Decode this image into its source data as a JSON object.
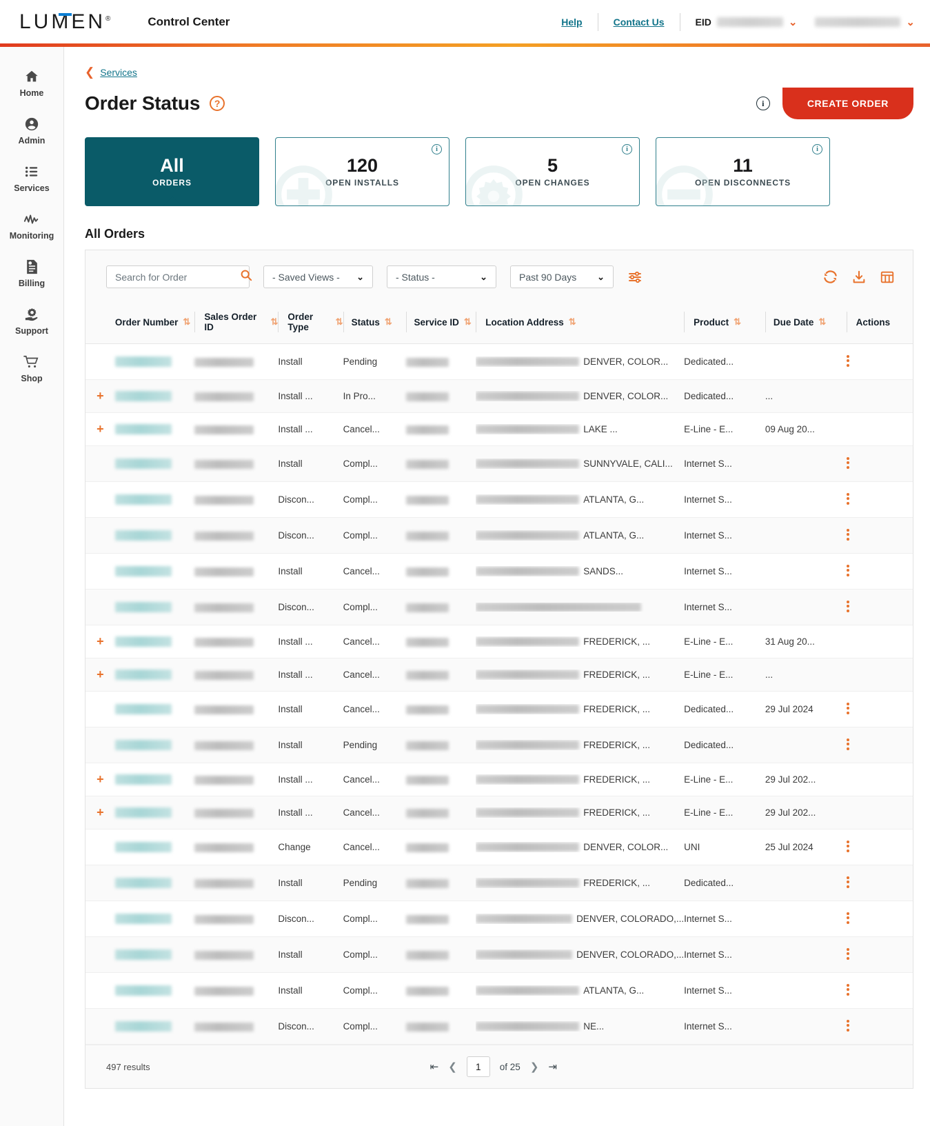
{
  "header": {
    "logo_text": "LUMEN",
    "logo_sup": "®",
    "app_name": "Control Center",
    "help_label": "Help",
    "contact_label": "Contact Us",
    "eid_label": "EID",
    "eid_value": "",
    "account_value": "",
    "caret_icon": "chevron-down-icon"
  },
  "sidebar": {
    "items": [
      {
        "label": "Home",
        "icon": "home-icon"
      },
      {
        "label": "Admin",
        "icon": "user-circle-icon"
      },
      {
        "label": "Services",
        "icon": "list-icon"
      },
      {
        "label": "Monitoring",
        "icon": "activity-icon"
      },
      {
        "label": "Billing",
        "icon": "invoice-icon"
      },
      {
        "label": "Support",
        "icon": "support-hand-gear-icon"
      },
      {
        "label": "Shop",
        "icon": "cart-icon"
      }
    ]
  },
  "breadcrumb": {
    "label": "Services",
    "back_icon": "chevron-left-icon"
  },
  "page": {
    "title": "Order Status",
    "help_icon": "question-circle-icon",
    "info_icon": "info-circle-icon",
    "create_button": "CREATE ORDER"
  },
  "cards": [
    {
      "value": "All",
      "label": "ORDERS",
      "selected": true,
      "watermark": "none"
    },
    {
      "value": "120",
      "label": "OPEN INSTALLS",
      "selected": false,
      "watermark": "plus-circle-icon"
    },
    {
      "value": "5",
      "label": "OPEN CHANGES",
      "selected": false,
      "watermark": "gear-circle-icon"
    },
    {
      "value": "11",
      "label": "OPEN DISCONNECTS",
      "selected": false,
      "watermark": "minus-circle-icon"
    }
  ],
  "section": {
    "title": "All Orders"
  },
  "toolbar": {
    "search_placeholder": "Search for Order",
    "search_value": "",
    "search_icon": "search-icon",
    "saved_views": "- Saved Views -",
    "status_filter": "- Status -",
    "date_range": "Past 90 Days",
    "filter_icon": "sliders-icon",
    "refresh_icon": "refresh-icon",
    "download_icon": "download-icon",
    "columns_icon": "table-columns-icon"
  },
  "table": {
    "columns": [
      {
        "label": "Order Number",
        "sortable": true
      },
      {
        "label": "Sales Order ID",
        "sortable": true
      },
      {
        "label": "Order Type",
        "sortable": true
      },
      {
        "label": "Status",
        "sortable": true
      },
      {
        "label": "Service ID",
        "sortable": true
      },
      {
        "label": "Location Address",
        "sortable": true
      },
      {
        "label": "Product",
        "sortable": true
      },
      {
        "label": "Due Date",
        "sortable": true
      },
      {
        "label": "Actions",
        "sortable": false
      }
    ],
    "sort_icon": "sort-arrows-icon",
    "rows": [
      {
        "expand": false,
        "order_number": "",
        "sales_order_id": "",
        "order_type": "Install",
        "status": "Pending",
        "service_id": "",
        "address_city": "DENVER, COLOR...",
        "product": "Dedicated...",
        "due_date": "",
        "actions": true
      },
      {
        "expand": true,
        "order_number": "",
        "sales_order_id": "",
        "order_type": "Install ...",
        "status": "In Pro...",
        "service_id": "",
        "address_city": "DENVER, COLOR...",
        "product": "Dedicated...",
        "due_date": "...",
        "actions": false
      },
      {
        "expand": true,
        "order_number": "",
        "sales_order_id": "",
        "order_type": "Install ...",
        "status": "Cancel...",
        "service_id": "",
        "address_city": "LAKE ...",
        "product": "E-Line - E...",
        "due_date": "09 Aug 20...",
        "actions": false
      },
      {
        "expand": false,
        "order_number": "",
        "sales_order_id": "",
        "order_type": "Install",
        "status": "Compl...",
        "service_id": "",
        "address_city": "SUNNYVALE, CALI...",
        "product": "Internet S...",
        "due_date": "",
        "actions": true
      },
      {
        "expand": false,
        "order_number": "",
        "sales_order_id": "",
        "order_type": "Discon...",
        "status": "Compl...",
        "service_id": "",
        "address_city": "ATLANTA, G...",
        "product": "Internet S...",
        "due_date": "",
        "actions": true
      },
      {
        "expand": false,
        "order_number": "",
        "sales_order_id": "",
        "order_type": "Discon...",
        "status": "Compl...",
        "service_id": "",
        "address_city": "ATLANTA, G...",
        "product": "Internet S...",
        "due_date": "",
        "actions": true
      },
      {
        "expand": false,
        "order_number": "",
        "sales_order_id": "",
        "order_type": "Install",
        "status": "Cancel...",
        "service_id": "",
        "address_city": "SANDS...",
        "product": "Internet S...",
        "due_date": "",
        "actions": true
      },
      {
        "expand": false,
        "order_number": "",
        "sales_order_id": "",
        "order_type": "Discon...",
        "status": "Compl...",
        "service_id": "",
        "address_city": "",
        "product": "Internet S...",
        "due_date": "",
        "actions": true
      },
      {
        "expand": true,
        "order_number": "",
        "sales_order_id": "",
        "order_type": "Install ...",
        "status": "Cancel...",
        "service_id": "",
        "address_city": "FREDERICK, ...",
        "product": "E-Line - E...",
        "due_date": "31 Aug 20...",
        "actions": false
      },
      {
        "expand": true,
        "order_number": "",
        "sales_order_id": "",
        "order_type": "Install ...",
        "status": "Cancel...",
        "service_id": "",
        "address_city": "FREDERICK, ...",
        "product": "E-Line - E...",
        "due_date": "...",
        "actions": false
      },
      {
        "expand": false,
        "order_number": "",
        "sales_order_id": "",
        "order_type": "Install",
        "status": "Cancel...",
        "service_id": "",
        "address_city": "FREDERICK, ...",
        "product": "Dedicated...",
        "due_date": "29 Jul 2024",
        "actions": true
      },
      {
        "expand": false,
        "order_number": "",
        "sales_order_id": "",
        "order_type": "Install",
        "status": "Pending",
        "service_id": "",
        "address_city": "FREDERICK, ...",
        "product": "Dedicated...",
        "due_date": "",
        "actions": true
      },
      {
        "expand": true,
        "order_number": "",
        "sales_order_id": "",
        "order_type": "Install ...",
        "status": "Cancel...",
        "service_id": "",
        "address_city": "FREDERICK, ...",
        "product": "E-Line - E...",
        "due_date": "29 Jul 202...",
        "actions": false
      },
      {
        "expand": true,
        "order_number": "",
        "sales_order_id": "",
        "order_type": "Install ...",
        "status": "Cancel...",
        "service_id": "",
        "address_city": "FREDERICK, ...",
        "product": "E-Line - E...",
        "due_date": "29 Jul 202...",
        "actions": false
      },
      {
        "expand": false,
        "order_number": "",
        "sales_order_id": "",
        "order_type": "Change",
        "status": "Cancel...",
        "service_id": "",
        "address_city": "DENVER, COLOR...",
        "product": "UNI",
        "due_date": "25 Jul 2024",
        "actions": true
      },
      {
        "expand": false,
        "order_number": "",
        "sales_order_id": "",
        "order_type": "Install",
        "status": "Pending",
        "service_id": "",
        "address_city": "FREDERICK, ...",
        "product": "Dedicated...",
        "due_date": "",
        "actions": true
      },
      {
        "expand": false,
        "order_number": "",
        "sales_order_id": "",
        "order_type": "Discon...",
        "status": "Compl...",
        "service_id": "",
        "address_city": "DENVER, COLORADO,...",
        "product": "Internet S...",
        "due_date": "",
        "actions": true
      },
      {
        "expand": false,
        "order_number": "",
        "sales_order_id": "",
        "order_type": "Install",
        "status": "Compl...",
        "service_id": "",
        "address_city": "DENVER, COLORADO,...",
        "product": "Internet S...",
        "due_date": "",
        "actions": true
      },
      {
        "expand": false,
        "order_number": "",
        "sales_order_id": "",
        "order_type": "Install",
        "status": "Compl...",
        "service_id": "",
        "address_city": "ATLANTA, G...",
        "product": "Internet S...",
        "due_date": "",
        "actions": true
      },
      {
        "expand": false,
        "order_number": "",
        "sales_order_id": "",
        "order_type": "Discon...",
        "status": "Compl...",
        "service_id": "",
        "address_city": "NE...",
        "product": "Internet S...",
        "due_date": "",
        "actions": true
      }
    ]
  },
  "footer": {
    "results": "497 results",
    "first_icon": "first-page-icon",
    "prev_icon": "prev-page-icon",
    "current_page": "1",
    "of_label": "of 25",
    "next_icon": "next-page-icon",
    "last_icon": "last-page-icon"
  },
  "colors": {
    "brand_red": "#d9301c",
    "brand_orange": "#e8722c",
    "teal_dark": "#0a5b68",
    "teal_link": "#11748a",
    "card_border": "#2f7f8c"
  }
}
